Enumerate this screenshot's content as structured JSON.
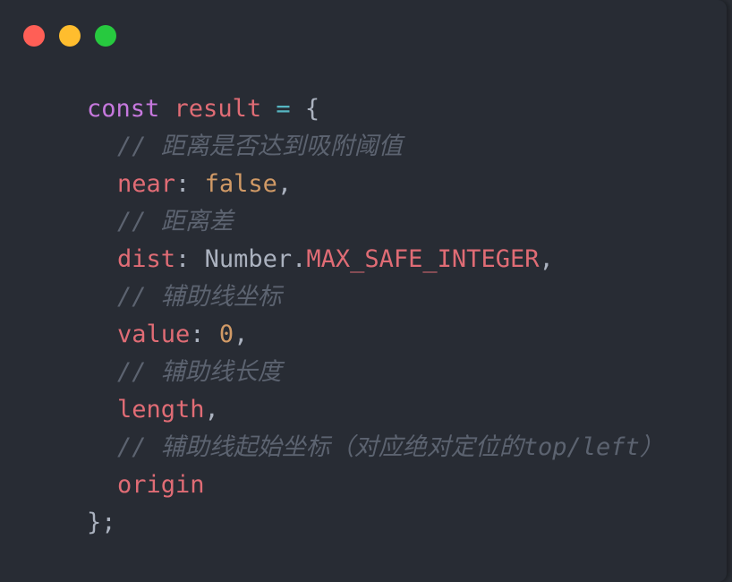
{
  "colors": {
    "window_bg": "#282c34",
    "keyword": "#c678dd",
    "variable": "#e06c75",
    "operator": "#56b6c2",
    "plain": "#abb2bf",
    "comment": "#5c6370",
    "literal": "#d19a66",
    "traffic_close": "#ff5f56",
    "traffic_minimize": "#ffbd2e",
    "traffic_zoom": "#27c93f"
  },
  "window_controls": {
    "close": "close-button",
    "minimize": "minimize-button",
    "zoom": "zoom-button"
  },
  "code": {
    "line1": {
      "keyword": "const",
      "name": "result",
      "op": "=",
      "brace": "{"
    },
    "line2": {
      "comment": "// 距离是否达到吸附阈值"
    },
    "line3": {
      "key": "near",
      "colon": ":",
      "value": "false",
      "comma": ","
    },
    "line4": {
      "comment": "// 距离差"
    },
    "line5": {
      "key": "dist",
      "colon": ":",
      "obj": "Number",
      "dot": ".",
      "prop": "MAX_SAFE_INTEGER",
      "comma": ","
    },
    "line6": {
      "comment": "// 辅助线坐标"
    },
    "line7": {
      "key": "value",
      "colon": ":",
      "value": "0",
      "comma": ","
    },
    "line8": {
      "comment": "// 辅助线长度"
    },
    "line9": {
      "key": "length",
      "comma": ","
    },
    "line10": {
      "comment": "// 辅助线起始坐标（对应绝对定位的top/left）"
    },
    "line11": {
      "key": "origin"
    },
    "line12": {
      "close": "};"
    }
  }
}
